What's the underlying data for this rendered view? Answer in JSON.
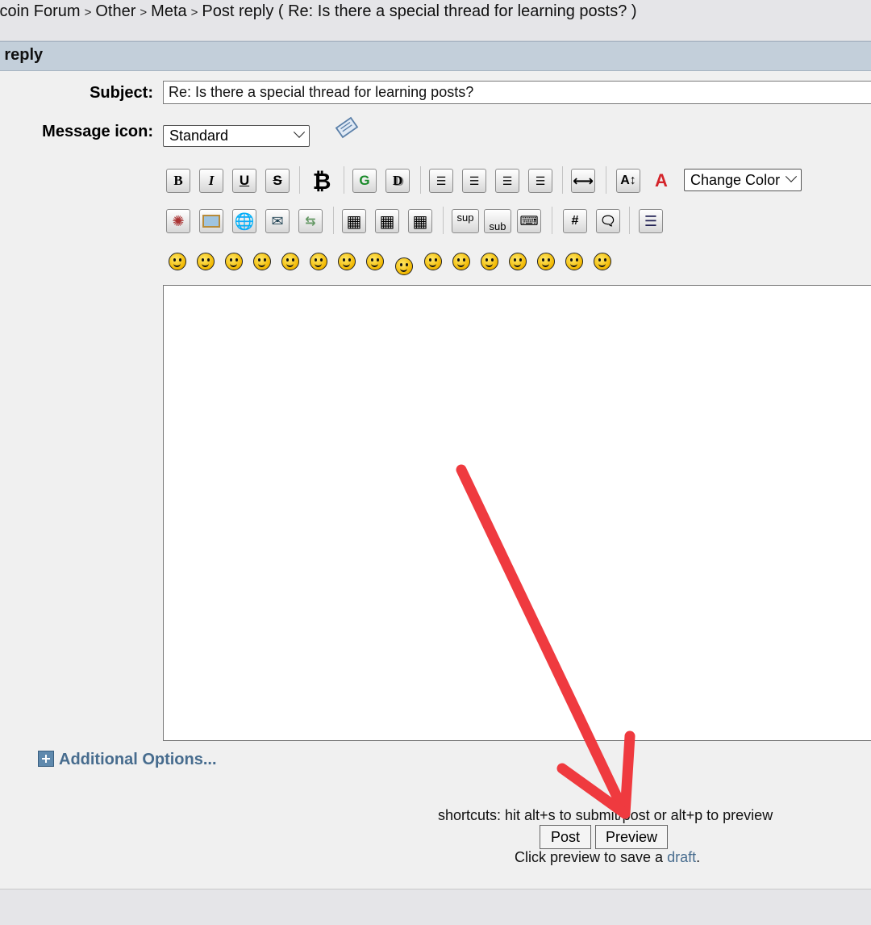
{
  "breadcrumb": {
    "items": [
      "tcoin Forum",
      "Other",
      "Meta",
      "Post reply ( Re: Is there a special thread for learning posts? )"
    ],
    "separator": ">"
  },
  "title_bar": {
    "title": "st reply"
  },
  "form": {
    "subject_label": "Subject:",
    "subject_value": "Re: Is there a special thread for learning posts?",
    "message_icon_label": "Message icon:",
    "message_icon_value": "Standard"
  },
  "toolbar": {
    "row1": [
      "bold",
      "italic",
      "underline",
      "strikethrough",
      "bitcoin",
      "glow",
      "shadow",
      "marquee",
      "left-align",
      "center",
      "right-align",
      "horizontal-rule",
      "font-size",
      "font-face"
    ],
    "change_color_label": "Change Color",
    "row2": [
      "flash",
      "image",
      "link",
      "email",
      "ftp",
      "table",
      "table-row",
      "table-cell",
      "superscript",
      "subscript",
      "teletype",
      "code",
      "quote",
      "list"
    ],
    "sup_label": "sup",
    "sub_label": "sub",
    "smileys": [
      "smiley",
      "wink",
      "cheesy",
      "grin",
      "angry",
      "sad",
      "shocked",
      "cool",
      "huh",
      "roll-eyes",
      "tongue",
      "embarrassed",
      "lips-sealed",
      "undecided",
      "kiss",
      "cry"
    ]
  },
  "additional_options": {
    "label": "Additional Options..."
  },
  "actions": {
    "shortcuts_text": "shortcuts: hit alt+s to submit/post or alt+p to preview",
    "post_label": "Post",
    "preview_label": "Preview",
    "draft_prefix": "Click preview to save a ",
    "draft_link": "draft",
    "draft_suffix": "."
  },
  "colors": {
    "title_bar": "#c3cfda",
    "link": "#476c8e",
    "annotation_arrow": "#ef3a3f"
  }
}
